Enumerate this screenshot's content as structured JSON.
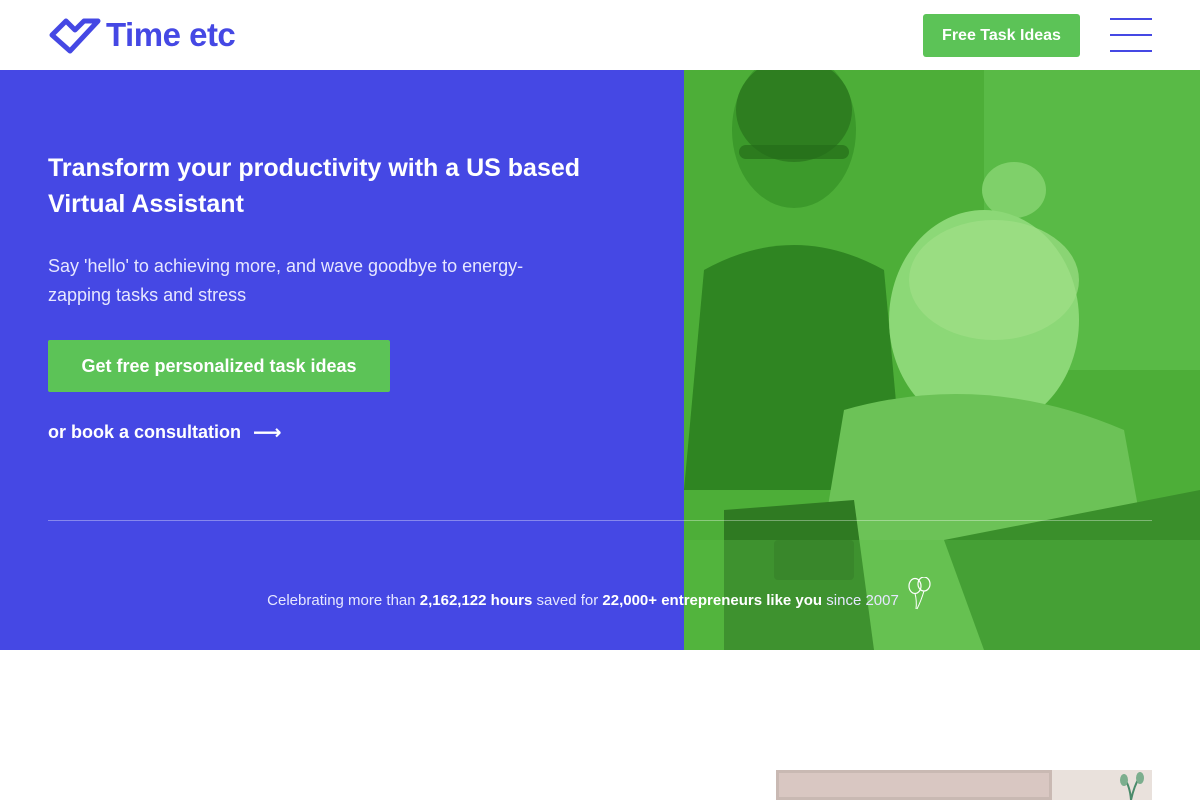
{
  "header": {
    "logo_text": "Time etc",
    "cta_label": "Free Task Ideas"
  },
  "hero": {
    "title": "Transform your productivity with a US based Virtual Assistant",
    "subtitle": "Say 'hello' to achieving more, and wave goodbye to energy-zapping tasks and stress",
    "primary_cta": "Get free personalized task ideas",
    "secondary_link": "or book a consultation",
    "arrow": "⟶"
  },
  "stats": {
    "prefix": "Celebrating more than",
    "hours": "2,162,122 hours",
    "middle": "saved for",
    "entrepreneurs": "22,000+ entrepreneurs like you",
    "suffix": "since 2007"
  },
  "icons": {
    "logo_mark": "checkmark-heart-icon",
    "menu": "hamburger-menu-icon",
    "arrow": "arrow-right-icon",
    "balloons": "balloons-icon"
  },
  "colors": {
    "brand_blue": "#4548e4",
    "cta_green": "#5cc357",
    "photo_green": "#4dae38"
  }
}
